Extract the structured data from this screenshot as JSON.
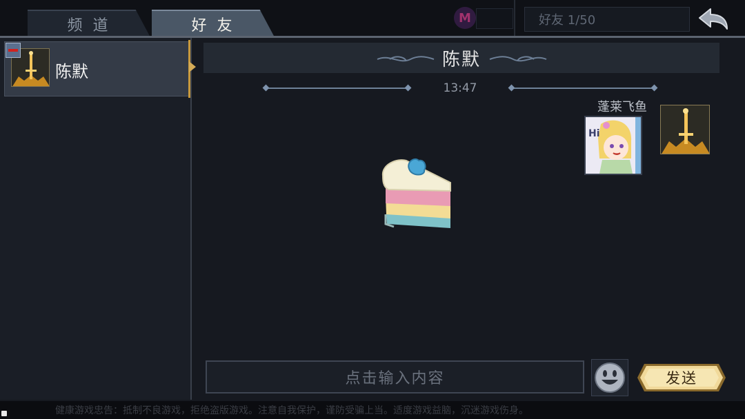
{
  "tabs": [
    {
      "label": "频 道",
      "active": false
    },
    {
      "label": "好 友",
      "active": true
    }
  ],
  "top": {
    "m_badge": "M",
    "friends_count": "好友 1/50"
  },
  "friends": [
    {
      "name": "陈默",
      "selected": true
    }
  ],
  "chat": {
    "title": "陈默",
    "time": "13:47",
    "sender_name": "蓬莱飞鱼"
  },
  "input": {
    "placeholder": "点击输入内容",
    "send_label": "发送"
  },
  "ticker": "健康游戏忠告：抵制不良游戏，拒绝盗版游戏。注意自我保护，谨防受骗上当。适度游戏益脑，沉迷游戏伤身。",
  "icons": [
    "sword-avatar-icon",
    "back-arrow-icon",
    "emoji-face-icon",
    "remove-friend-icon",
    "cake-gift-icon",
    "hi-sticker-icon"
  ],
  "colors": {
    "accent_gold": "#d4ab57",
    "tab_active": "#4a5766"
  }
}
